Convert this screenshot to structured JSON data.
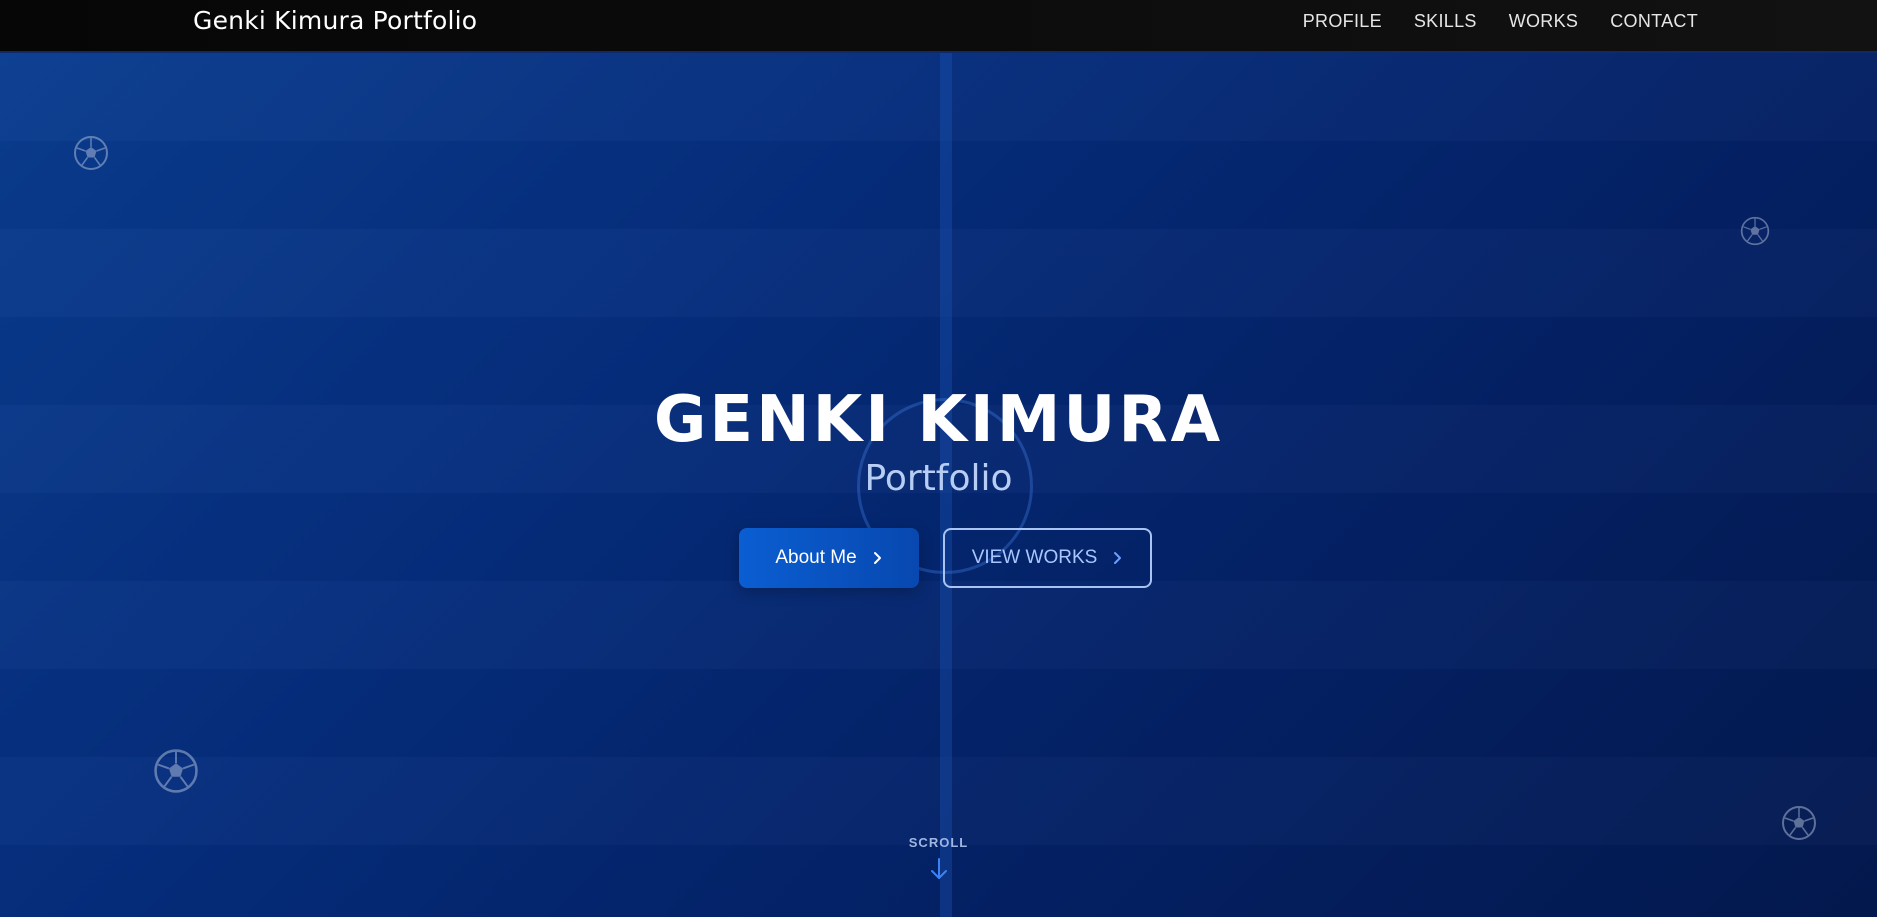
{
  "header": {
    "brand": "Genki Kimura Portfolio",
    "nav": [
      {
        "label": "PROFILE"
      },
      {
        "label": "SKILLS"
      },
      {
        "label": "WORKS"
      },
      {
        "label": "CONTACT"
      }
    ]
  },
  "hero": {
    "title": "GENKI KIMURA",
    "subtitle": "Portfolio",
    "primary_button": {
      "label": "About Me",
      "icon": "chevron-right-icon"
    },
    "secondary_button": {
      "label": "VIEW WORKS",
      "icon": "chevron-right-icon"
    },
    "scroll": {
      "label": "SCROLL",
      "icon": "arrow-down-icon"
    },
    "decorations": [
      "soccer-ball-icon",
      "soccer-ball-icon",
      "soccer-ball-icon",
      "soccer-ball-icon"
    ]
  },
  "colors": {
    "header_bg": "#0b0b0b",
    "hero_bg": "#052d7c",
    "primary_button": "#0a5ed2",
    "secondary_border": "#a9c3f2",
    "subtitle": "#b7cdf3",
    "accent": "#3b82f6"
  }
}
